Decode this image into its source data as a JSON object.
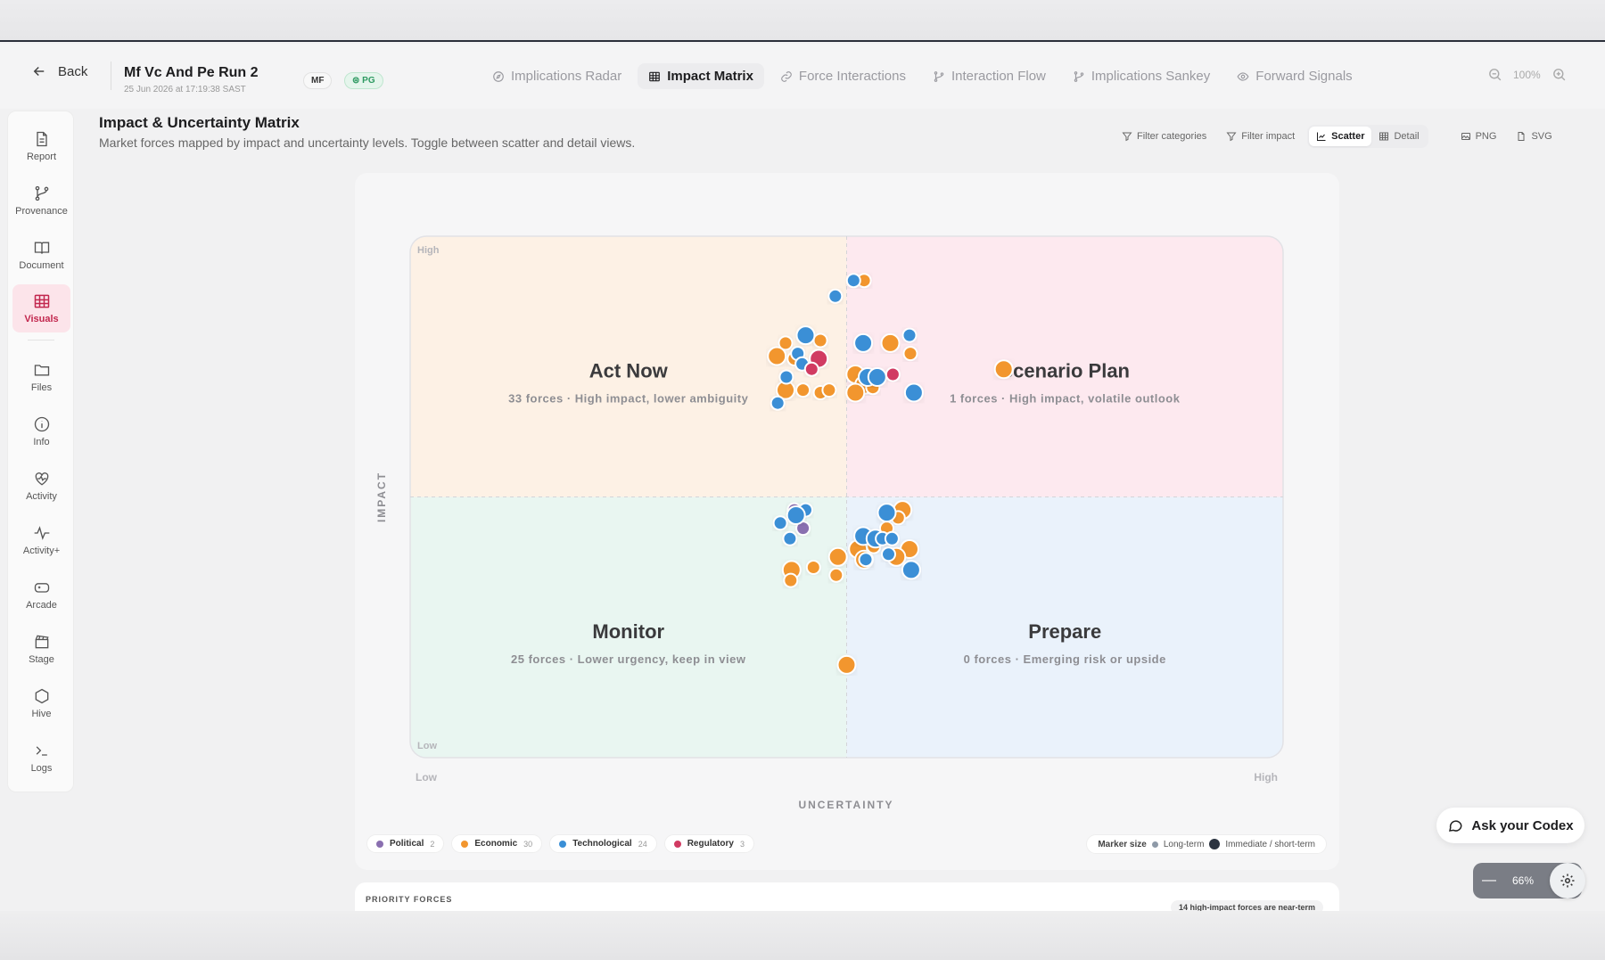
{
  "header": {
    "back_label": "Back",
    "run_title": "Mf Vc And Pe Run 2",
    "run_date": "25 Jun 2026 at 17:19:38 SAST",
    "badge_mf": "MF",
    "badge_pg": "PG",
    "tabs": [
      {
        "label": "Implications Radar",
        "icon": "compass-icon",
        "active": false
      },
      {
        "label": "Impact Matrix",
        "icon": "grid-icon",
        "active": true
      },
      {
        "label": "Force Interactions",
        "icon": "link-icon",
        "active": false
      },
      {
        "label": "Interaction Flow",
        "icon": "branch-icon",
        "active": false
      },
      {
        "label": "Implications Sankey",
        "icon": "branch-icon",
        "active": false
      },
      {
        "label": "Forward Signals",
        "icon": "eye-icon",
        "active": false
      }
    ],
    "zoom": "100%"
  },
  "sidebar": {
    "items": [
      {
        "label": "Report",
        "icon": "file-icon"
      },
      {
        "label": "Provenance",
        "icon": "git-branch-icon"
      },
      {
        "label": "Document",
        "icon": "book-icon"
      },
      {
        "label": "Visuals",
        "icon": "table-icon",
        "active": true
      },
      {
        "label": "Files",
        "icon": "folder-icon"
      },
      {
        "label": "Info",
        "icon": "info-icon"
      },
      {
        "label": "Activity",
        "icon": "heart-pulse-icon"
      },
      {
        "label": "Activity+",
        "icon": "pulse-icon"
      },
      {
        "label": "Arcade",
        "icon": "gamepad-icon"
      },
      {
        "label": "Stage",
        "icon": "clapper-icon"
      },
      {
        "label": "Hive",
        "icon": "hexagon-icon"
      },
      {
        "label": "Logs",
        "icon": "terminal-icon"
      }
    ]
  },
  "page": {
    "title": "Impact & Uncertainty Matrix",
    "subtitle": "Market forces mapped by impact and uncertainty levels. Toggle between scatter and detail views."
  },
  "toolbar": {
    "filter_categories": "Filter categories",
    "filter_impact": "Filter impact",
    "scatter": "Scatter",
    "detail": "Detail",
    "png": "PNG",
    "svg": "SVG"
  },
  "chart_data": {
    "type": "scatter",
    "xlabel": "UNCERTAINTY",
    "ylabel": "IMPACT",
    "x_ticks": [
      "Low",
      "High"
    ],
    "y_ticks": [
      "High",
      "Low"
    ],
    "xlim": [
      0,
      1
    ],
    "ylim": [
      0,
      1
    ],
    "quadrants": [
      {
        "name": "Act Now",
        "desc": "33 forces · High impact, lower ambiguity",
        "color": "#fdf1e5"
      },
      {
        "name": "Scenario Plan",
        "desc": "1 forces · High impact, volatile outlook",
        "color": "#fde9ef"
      },
      {
        "name": "Monitor",
        "desc": "25 forces · Lower urgency, keep in view",
        "color": "#e9f6f1"
      },
      {
        "name": "Prepare",
        "desc": "0 forces · Emerging risk or upside",
        "color": "#eaf2fb"
      }
    ],
    "categories": [
      {
        "name": "Political",
        "count": "2",
        "color": "#8a6fb0"
      },
      {
        "name": "Economic",
        "count": "30",
        "color": "#f2962f"
      },
      {
        "name": "Technological",
        "count": "24",
        "color": "#3a8fd6"
      },
      {
        "name": "Regulatory",
        "count": "3",
        "color": "#d13a62"
      }
    ],
    "series": [
      {
        "name": "Political",
        "points": [
          [
            0.44,
            0.475,
            0
          ],
          [
            0.45,
            0.44,
            0
          ]
        ]
      },
      {
        "name": "Economic",
        "points": [
          [
            0.52,
            0.915,
            0
          ],
          [
            0.43,
            0.795,
            0
          ],
          [
            0.47,
            0.8,
            0
          ],
          [
            0.42,
            0.77,
            1
          ],
          [
            0.44,
            0.765,
            0
          ],
          [
            0.51,
            0.735,
            1
          ],
          [
            0.52,
            0.715,
            1
          ],
          [
            0.43,
            0.705,
            1
          ],
          [
            0.45,
            0.705,
            0
          ],
          [
            0.47,
            0.7,
            0
          ],
          [
            0.48,
            0.705,
            0
          ],
          [
            0.51,
            0.7,
            1
          ],
          [
            0.53,
            0.71,
            0
          ],
          [
            0.55,
            0.795,
            1
          ],
          [
            0.573,
            0.775,
            0
          ],
          [
            0.68,
            0.745,
            1
          ],
          [
            0.564,
            0.475,
            1
          ],
          [
            0.559,
            0.46,
            0
          ],
          [
            0.546,
            0.44,
            0
          ],
          [
            0.513,
            0.4,
            1
          ],
          [
            0.49,
            0.385,
            1
          ],
          [
            0.462,
            0.365,
            0
          ],
          [
            0.437,
            0.36,
            1
          ],
          [
            0.436,
            0.34,
            0
          ],
          [
            0.488,
            0.35,
            0
          ],
          [
            0.572,
            0.4,
            1
          ],
          [
            0.557,
            0.385,
            1
          ],
          [
            0.52,
            0.38,
            1
          ],
          [
            0.5,
            0.178,
            1
          ],
          [
            0.531,
            0.405,
            0
          ]
        ]
      },
      {
        "name": "Technological",
        "points": [
          [
            0.508,
            0.915,
            0
          ],
          [
            0.487,
            0.885,
            0
          ],
          [
            0.453,
            0.81,
            1
          ],
          [
            0.444,
            0.775,
            0
          ],
          [
            0.449,
            0.755,
            0
          ],
          [
            0.431,
            0.73,
            0
          ],
          [
            0.519,
            0.795,
            1
          ],
          [
            0.572,
            0.81,
            0
          ],
          [
            0.524,
            0.73,
            1
          ],
          [
            0.535,
            0.73,
            1
          ],
          [
            0.577,
            0.7,
            1
          ],
          [
            0.421,
            0.68,
            0
          ],
          [
            0.453,
            0.475,
            0
          ],
          [
            0.442,
            0.465,
            1
          ],
          [
            0.424,
            0.45,
            0
          ],
          [
            0.435,
            0.42,
            0
          ],
          [
            0.546,
            0.47,
            1
          ],
          [
            0.519,
            0.425,
            1
          ],
          [
            0.522,
            0.38,
            0
          ],
          [
            0.533,
            0.42,
            1
          ],
          [
            0.541,
            0.42,
            0
          ],
          [
            0.552,
            0.42,
            0
          ],
          [
            0.548,
            0.39,
            0
          ],
          [
            0.574,
            0.36,
            1
          ]
        ]
      },
      {
        "name": "Regulatory",
        "points": [
          [
            0.468,
            0.765,
            1
          ],
          [
            0.46,
            0.745,
            0
          ],
          [
            0.553,
            0.735,
            0
          ]
        ]
      }
    ],
    "marker_size_label": "Marker size",
    "marker_small_label": "Long-term",
    "marker_large_label": "Immediate / short-term"
  },
  "priority": {
    "title": "PRIORITY FORCES",
    "note": "14 high-impact forces are near-term"
  },
  "assistant": {
    "ask_label": "Ask your Codex",
    "zoom_value": "66%"
  }
}
